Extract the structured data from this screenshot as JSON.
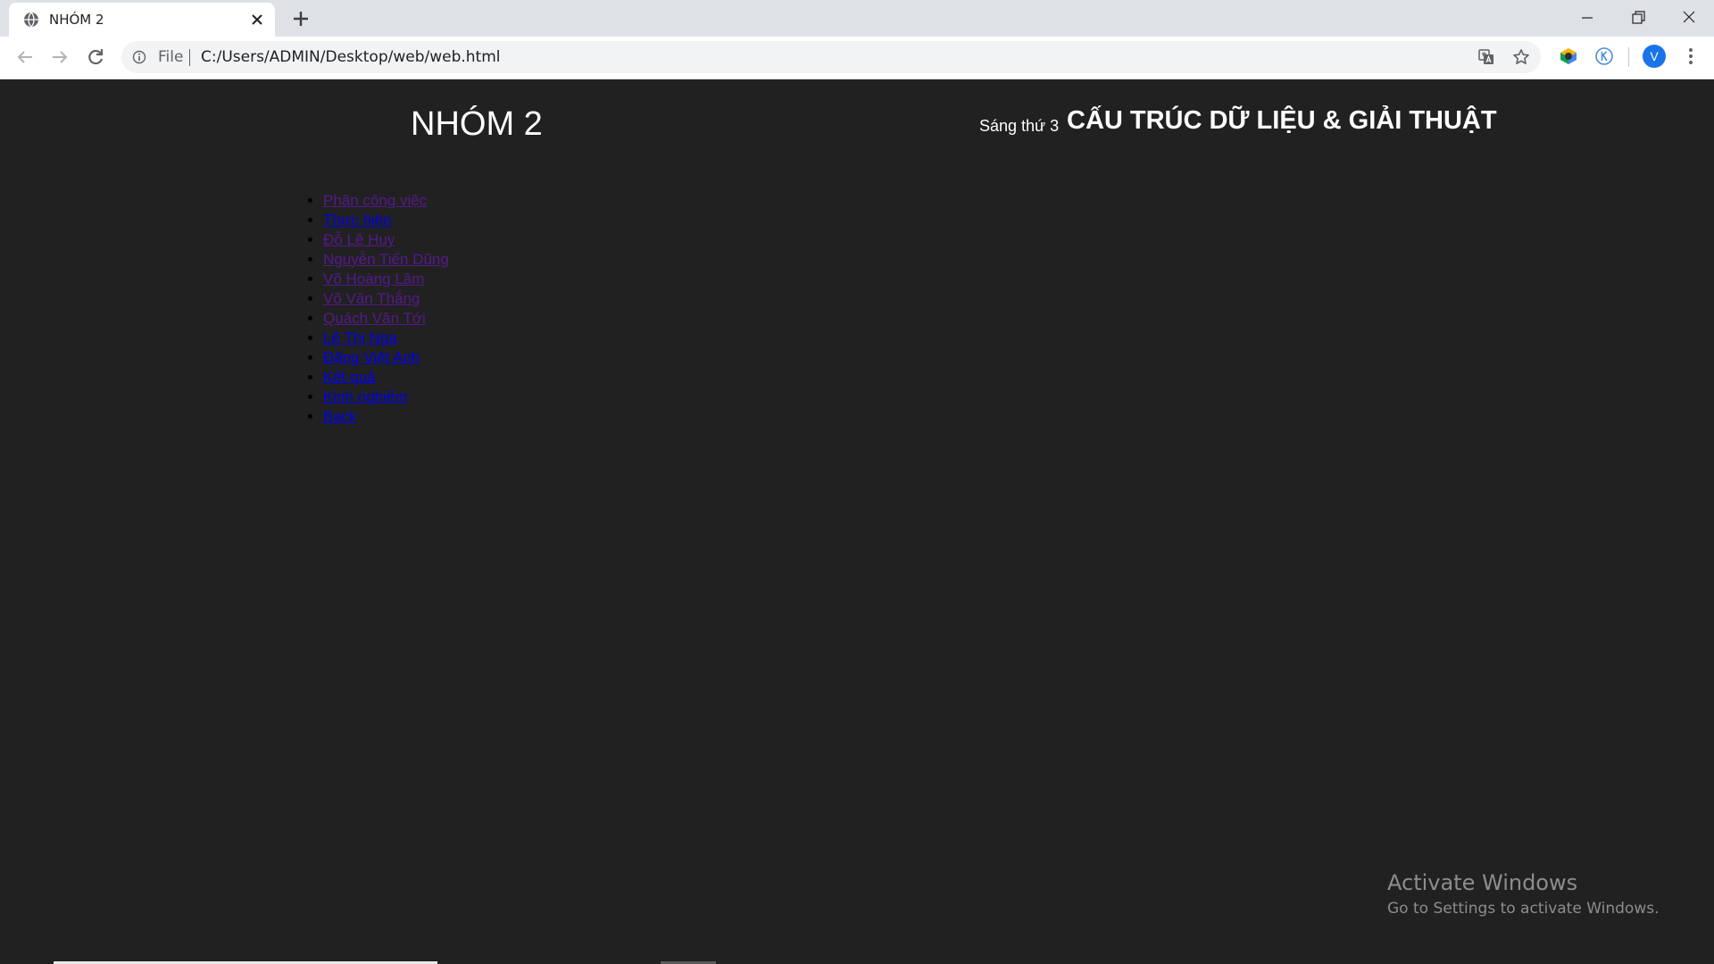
{
  "browser": {
    "tab": {
      "title": "NHÓM 2",
      "favicon": "globe-icon"
    },
    "omnibox": {
      "scheme": "File",
      "url": "C:/Users/ADMIN/Desktop/web/web.html"
    },
    "profile_initial": "V",
    "icons": {
      "back": "arrow-left-icon",
      "forward": "arrow-right-icon",
      "reload": "reload-icon",
      "info": "info-icon",
      "translate": "translate-icon",
      "bookmark": "star-icon",
      "menu": "kebab-menu-icon"
    }
  },
  "page": {
    "group_title": "NHÓM 2",
    "session": "Sáng thứ 3",
    "course": "CẤU TRÚC DỮ LIỆU & GIẢI THUẬT",
    "links": [
      {
        "label": "Phân công việc",
        "visited": true
      },
      {
        "label": "Thực hiện",
        "visited": false
      },
      {
        "label": "Đỗ Lê Huy",
        "visited": true
      },
      {
        "label": "Nguyễn Tiến Dũng",
        "visited": true
      },
      {
        "label": "Võ Hoàng Lâm",
        "visited": true
      },
      {
        "label": "Võ Văn Thắng",
        "visited": true
      },
      {
        "label": "Quách Văn Tới",
        "visited": true
      },
      {
        "label": "Lê Thị Nga",
        "visited": false
      },
      {
        "label": "Đặng Việt Anh",
        "visited": false
      },
      {
        "label": "Kết quả",
        "visited": false
      },
      {
        "label": "Kinh nghiệm",
        "visited": false
      },
      {
        "label": "Back",
        "visited": false
      }
    ],
    "colors": {
      "background": "#212121",
      "visited_link": "#551a8b",
      "unvisited_link": "#0000ee"
    }
  },
  "watermark": {
    "title": "Activate Windows",
    "subtitle": "Go to Settings to activate Windows."
  }
}
